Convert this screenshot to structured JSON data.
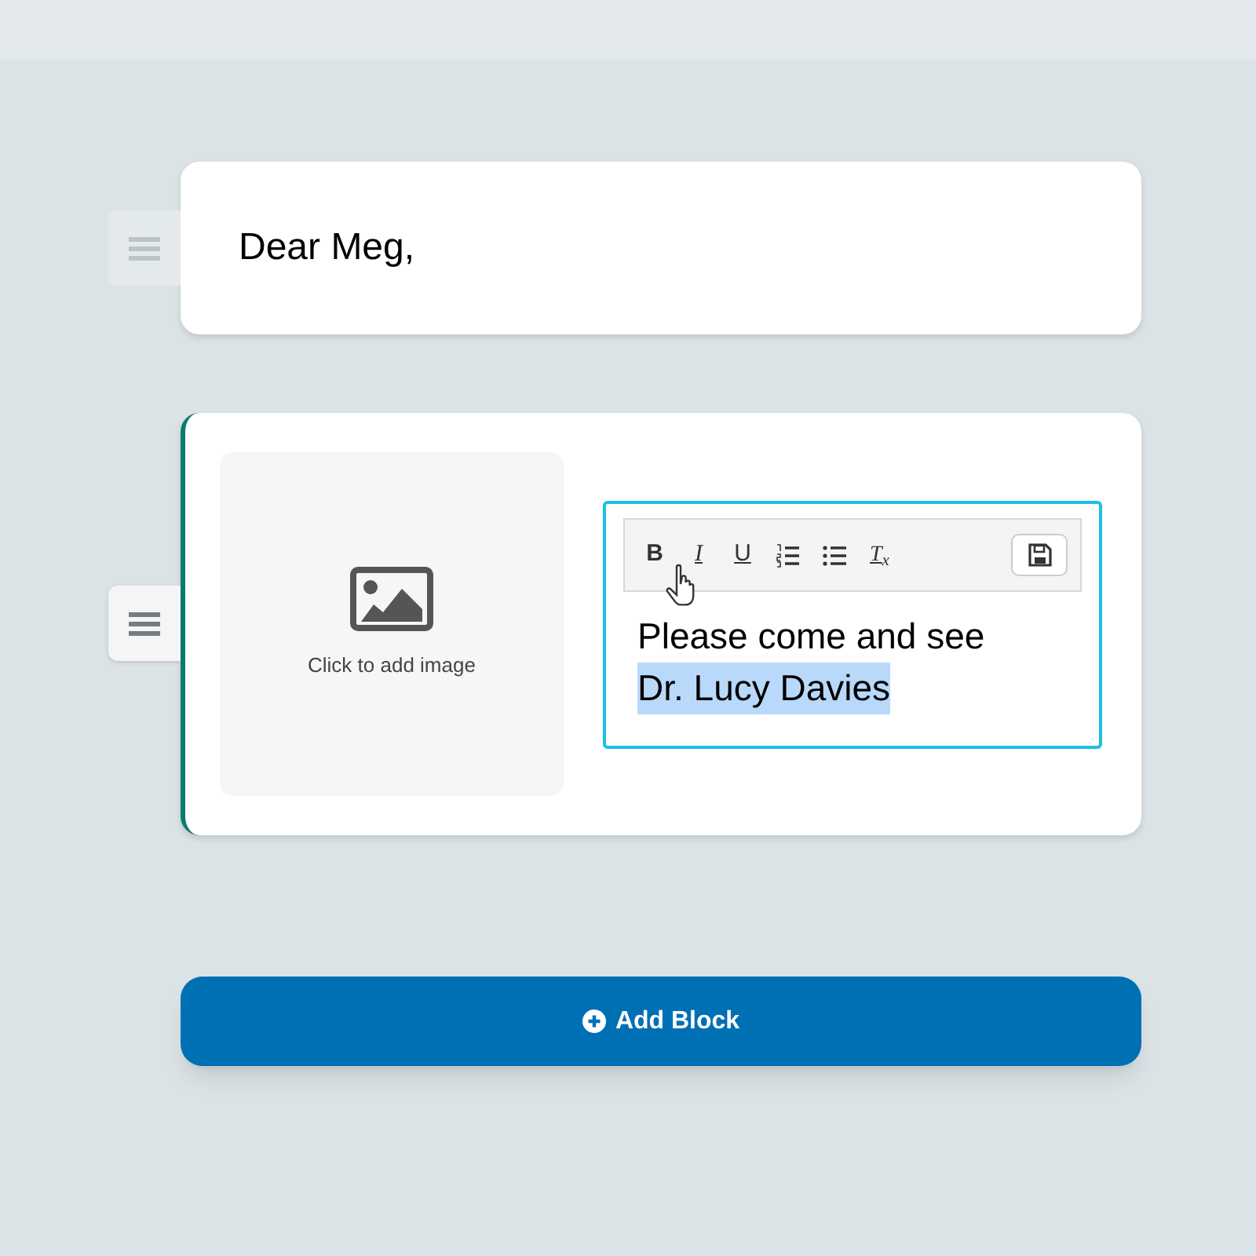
{
  "blocks": [
    {
      "kind": "text",
      "active": false,
      "text": "Dear Meg,"
    },
    {
      "kind": "image_text",
      "active": true,
      "image_prompt": "Click to add image",
      "editor": {
        "toolbar": [
          {
            "kind": "bold",
            "label": "B"
          },
          {
            "kind": "italic",
            "label": "I"
          },
          {
            "kind": "underline",
            "label": "U"
          },
          {
            "kind": "ordered-list"
          },
          {
            "kind": "bullet-list"
          },
          {
            "kind": "clear-format",
            "label": "T$_{x}$"
          }
        ],
        "runs": [
          {
            "text": "Please come and see",
            "selected": false
          },
          {
            "text": "Dr. Lucy Davies",
            "selected": true
          }
        ]
      }
    }
  ],
  "add_button": {
    "label": "Add Block"
  }
}
